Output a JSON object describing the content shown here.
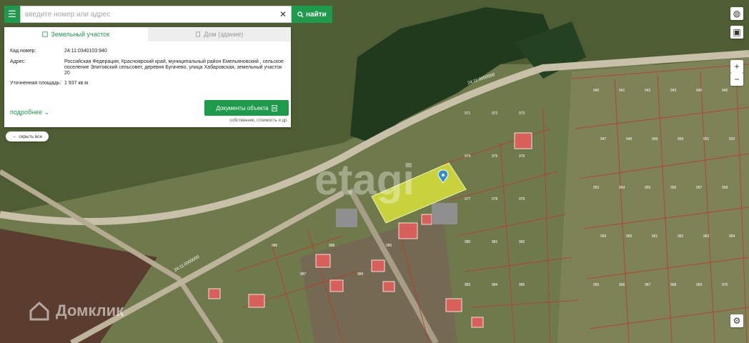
{
  "search": {
    "placeholder": "введите номер или адрес",
    "button_label": "найти"
  },
  "panel": {
    "tabs": [
      {
        "label": "Земельный участок",
        "active": true
      },
      {
        "label": "Дом (здание)",
        "active": false
      }
    ],
    "fields": [
      {
        "key": "Кад.номер:",
        "value": "24:11:0340103:940"
      },
      {
        "key": "Адрес:",
        "value": "Российская Федерация, Красноярский край, муниципальный район Емельяновский , сельское поселение Элитовский сельсовет, деревня Бугачево, улица Хабаровская, земельный участок 20"
      },
      {
        "key": "Уточненная площадь:",
        "value": "1 937 кв.м"
      }
    ],
    "more_label": "подробнее",
    "doc_button": "Документы объекта",
    "doc_sub": "собственник, стоимость и др."
  },
  "hide_all_label": "скрыть все",
  "watermark": {
    "brand": "Домклик",
    "overlay": "etagi"
  },
  "map_labels": {
    "road": "24:11:0000000",
    "parcels": [
      "940",
      "941",
      "942",
      "943",
      "945",
      "946",
      "947",
      "948",
      "949",
      "950",
      "951",
      "952",
      "953",
      "954",
      "955",
      "956",
      "957",
      "958",
      "959",
      "960",
      "961",
      "962",
      "963",
      "964",
      "965",
      "966",
      "967",
      "968",
      "969",
      "970",
      "971",
      "972",
      "973",
      "974",
      "975",
      "976",
      "977",
      "978",
      "979",
      "980",
      "981",
      "982",
      "983",
      "984",
      "985",
      "986",
      "987",
      "988",
      "989",
      "990"
    ]
  },
  "controls": {
    "zoom_in": "+",
    "zoom_out": "−"
  },
  "colors": {
    "accent": "#1e9a4c",
    "highlight": "#d8e23a",
    "boundary": "#c0392b",
    "marker": "#2f8fd6"
  }
}
